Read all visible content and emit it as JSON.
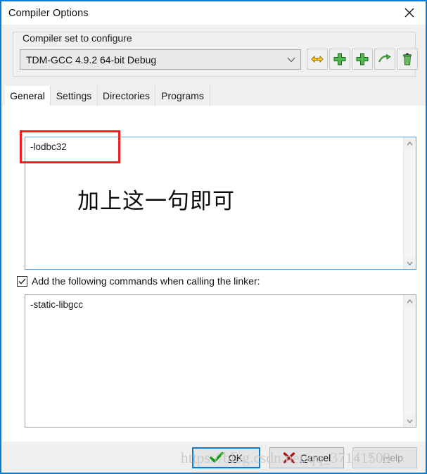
{
  "window": {
    "title": "Compiler Options",
    "close_icon": "close-icon",
    "border_color": "#0a7cd6"
  },
  "compiler_set": {
    "group_label": "Compiler set to configure",
    "selected": "TDM-GCC 4.9.2 64-bit Debug",
    "dropdown_icon": "chevron-down-icon",
    "tools": [
      {
        "name": "rename-compiler-set-icon",
        "glyph": "yellow-double-arrow"
      },
      {
        "name": "add-compiler-set-icon",
        "glyph": "green-plus"
      },
      {
        "name": "duplicate-compiler-set-icon",
        "glyph": "green-plus"
      },
      {
        "name": "find-compiler-set-icon",
        "glyph": "green-arrow"
      },
      {
        "name": "delete-compiler-set-icon",
        "glyph": "green-trash"
      }
    ]
  },
  "tabs": [
    {
      "label": "General",
      "active": true
    },
    {
      "label": "Settings",
      "active": false
    },
    {
      "label": "Directories",
      "active": false
    },
    {
      "label": "Programs",
      "active": false
    }
  ],
  "compiler_commands": {
    "value": "-lodbc32",
    "annotation": "加上这一句即可",
    "annotation_box_color": "#f02020",
    "focused": true
  },
  "linker": {
    "checkbox_label": "Add the following commands when calling the linker:",
    "checked": true,
    "value": "-static-libgcc"
  },
  "footer": {
    "ok": {
      "label_before": "",
      "label_accel": "O",
      "label_after": "K",
      "full": "OK",
      "icon": "green-check-icon",
      "default": true
    },
    "cancel": {
      "full": "Cancel",
      "label_before": "",
      "label_accel": "C",
      "label_after": "ancel",
      "icon": "red-cross-icon"
    },
    "help": {
      "full": "Help",
      "label_before": "",
      "label_accel": "H",
      "label_after": "elp",
      "icon": "question-mark-icon",
      "disabled": true
    }
  },
  "watermark": {
    "text": "https://blog.csdn.net/qq_37141509"
  }
}
